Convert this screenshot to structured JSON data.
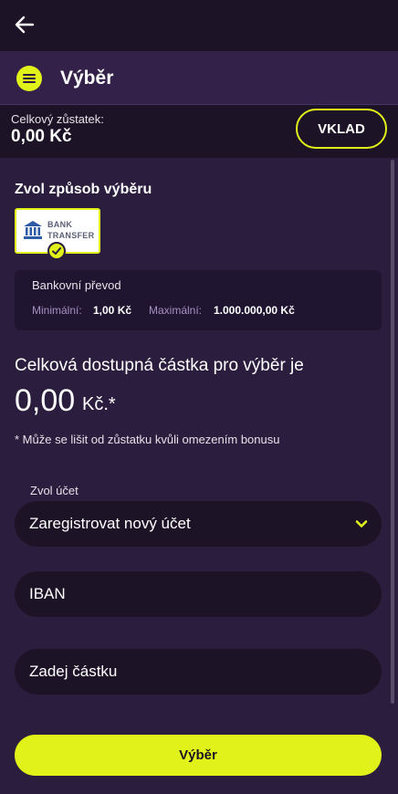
{
  "header": {
    "title": "Výběr"
  },
  "balance": {
    "label": "Celkový zůstatek:",
    "value": "0,00 Kč",
    "deposit_label": "VKLAD"
  },
  "method": {
    "title": "Zvol způsob výběru",
    "card_line1": "BANK",
    "card_line2": "TRANSFER",
    "name": "Bankovní převod",
    "min_label": "Minimální:",
    "min_value": "1,00 Kč",
    "max_label": "Maximální:",
    "max_value": "1.000.000,00 Kč"
  },
  "available": {
    "label": "Celková dostupná částka pro výběr je",
    "amount": "0,00",
    "currency": "Kč.*",
    "note": "* Může se lišit od zůstatku kvůli omezením bonusu"
  },
  "form": {
    "account_label": "Zvol účet",
    "account_value": "Zaregistrovat nový účet",
    "iban_placeholder": "IBAN",
    "amount_placeholder": "Zadej částku"
  },
  "footer": {
    "submit_label": "Výběr"
  },
  "colors": {
    "accent": "#e0f21a",
    "background": "#2b1d3e",
    "dark": "#1d1326"
  },
  "icons": [
    "back-arrow-icon",
    "menu-icon",
    "bank-icon",
    "check-icon",
    "chevron-down-icon"
  ]
}
